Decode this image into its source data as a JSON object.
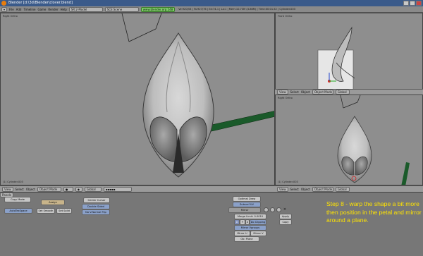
{
  "window": {
    "title": "Blender [d:\\3d\\Blender\\clover.blend]"
  },
  "menu": {
    "items": [
      "File",
      "Add",
      "Timeline",
      "Game",
      "Render",
      "Help"
    ],
    "screen": "SR:2-Model",
    "scene": "SCE:Scene",
    "site": "www.blender.org 248",
    "stats": "Ve:920/53 | Fa:927/76 | Ed:74-1 | La:1 | Mem:10.73M (3.86M) | Time:00:01.52 | Cylinder.003"
  },
  "viewports": {
    "main": {
      "label": "Right Ortho",
      "footer": "(1) Cylinder.003"
    },
    "topright": {
      "label": "Front Ortho",
      "footer": "(1) Cylinder.003"
    },
    "bottomright": {
      "label": "Right Ortho",
      "footer": "(1) Cylinder.003"
    }
  },
  "header": {
    "view": "View",
    "select": "Select",
    "object": "Object",
    "mode": "Object Mode",
    "pivot": "Global"
  },
  "buttons": {
    "panels_label": "Panels",
    "row1": [
      "Copy Mode",
      "Assign"
    ],
    "set_smooth": "Set Smooth",
    "set_solid": "Set Solid",
    "autotexspace": "AutoTexSpace",
    "center_cursor": "Center Cursor",
    "double_sided": "Double Sided",
    "no_v_normal_flip": "No V.Normal Flip",
    "optimal_draw": "Optimal Draw",
    "subsurf_uv": "Subsurf UV",
    "mirror_modifier": "Mirror",
    "merge_limit": "Merge Limit: 0.0010",
    "axis_y": "Y",
    "axis_z": "Z",
    "do_clipping": "Do Clipping",
    "mirror_vgroups": "Mirror Vgroups",
    "mirror_u": "Mirror U",
    "mirror_v": "Mirror V",
    "ob_plane": "Ob: Plane",
    "apply": "Apply",
    "copy": "Copy"
  },
  "caption": "Step 8 - warp the shape a bit more then position in the petal and mirror around a plane.",
  "colors": {
    "caption": "#ffe400",
    "stem": "#1a5a2a",
    "viewport": "#8e8e8e"
  }
}
